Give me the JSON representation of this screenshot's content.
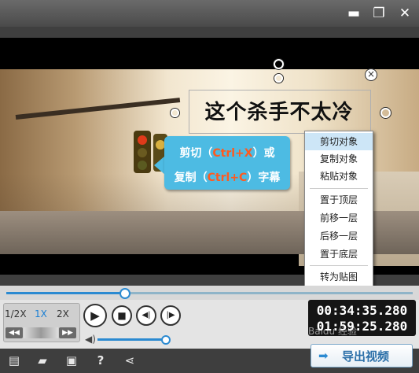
{
  "window": {
    "minimize_glyph": "▬",
    "restore_glyph": "❐",
    "close_glyph": "✕"
  },
  "video": {
    "caption": "这个杀手不太冷",
    "caption_close_glyph": "×"
  },
  "tooltip": {
    "line1_a": "剪切（",
    "line1_key": "Ctrl+X",
    "line1_b": "）或",
    "line2_a": "复制（",
    "line2_key": "Ctrl+C",
    "line2_b": "）字幕"
  },
  "context_menu": {
    "items": [
      {
        "label": "剪切对象",
        "selected": true
      },
      {
        "label": "复制对象"
      },
      {
        "label": "粘贴对象"
      },
      {
        "label": "置于顶层"
      },
      {
        "label": "前移一层"
      },
      {
        "label": "后移一层"
      },
      {
        "label": "置于底层"
      },
      {
        "label": "转为贴图"
      }
    ]
  },
  "timeline": {
    "progress": 0.29
  },
  "controls": {
    "speed_half": "1/2X",
    "speed_1x": "1X",
    "speed_2x": "2X",
    "step_back_glyph": "◀◀",
    "step_fwd_glyph": "▶▶",
    "play_glyph": "▶",
    "stop_glyph": "■",
    "prev_glyph": "◀|",
    "next_glyph": "|▶",
    "volume_glyph": "◀)",
    "volume_level": 1.0
  },
  "timecode": {
    "current": "00:34:35.280",
    "total": "01:59:25.280"
  },
  "toolbar": {
    "new_icon": "new-icon",
    "open_icon": "folder-icon",
    "save_icon": "save-icon",
    "help_icon": "help-icon",
    "share_icon": "share-icon",
    "new_glyph": "▤",
    "open_glyph": "▰",
    "save_glyph": "▣",
    "help_glyph": "?",
    "share_glyph": "⋖",
    "export_label": "导出视频",
    "export_glyph": "➡"
  },
  "watermark": "Baidu 经验",
  "colors": {
    "accent": "#2b8ad1",
    "tooltip_bg": "#4dbbe3",
    "hotkey": "#ff5a1f"
  }
}
